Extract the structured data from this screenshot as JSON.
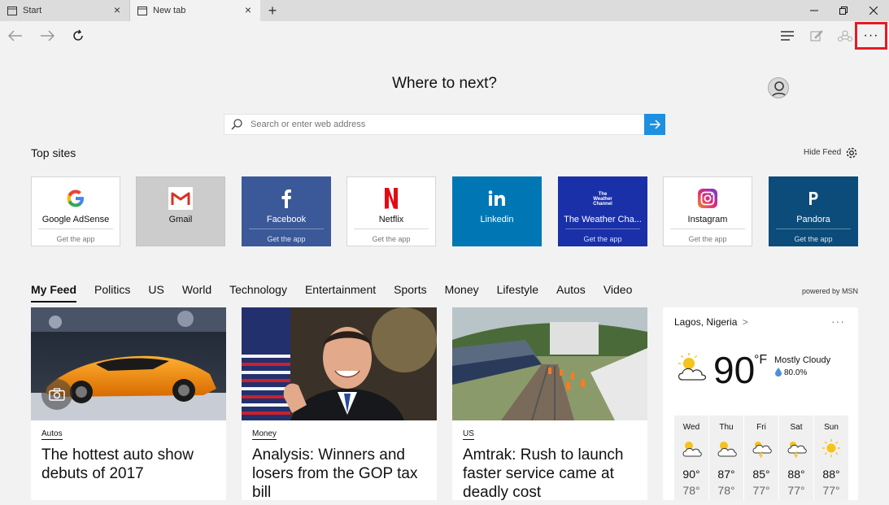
{
  "tabs": [
    {
      "label": "Start"
    },
    {
      "label": "New tab"
    }
  ],
  "hero": {
    "title": "Where to next?",
    "search_placeholder": "Search or enter web address"
  },
  "topsites": {
    "title": "Top sites",
    "hide_feed": "Hide Feed",
    "items": [
      {
        "name": "Google AdSense",
        "action": "Get the app",
        "bg": "#ffffff"
      },
      {
        "name": "Gmail",
        "action": "",
        "bg": "#cccccc"
      },
      {
        "name": "Facebook",
        "action": "Get the app",
        "bg": "#3b5998"
      },
      {
        "name": "Netflix",
        "action": "Get the app",
        "bg": "#ffffff"
      },
      {
        "name": "Linkedin",
        "action": "",
        "bg": "#0077b5"
      },
      {
        "name": "The Weather Cha...",
        "action": "Get the app",
        "bg": "#1a30a8",
        "logo_text": "The Weather Channel"
      },
      {
        "name": "Instagram",
        "action": "Get the app",
        "bg": "#ffffff"
      },
      {
        "name": "Pandora",
        "action": "Get the app",
        "bg": "#0b4c7a"
      }
    ]
  },
  "feed": {
    "tabs": [
      "My Feed",
      "Politics",
      "US",
      "World",
      "Technology",
      "Entertainment",
      "Sports",
      "Money",
      "Lifestyle",
      "Autos",
      "Video"
    ],
    "active_tab": "My Feed",
    "powered_by": "powered by MSN",
    "cards": [
      {
        "category": "Autos",
        "title": "The hottest auto show debuts of 2017"
      },
      {
        "category": "Money",
        "title": "Analysis: Winners and losers from the GOP tax bill"
      },
      {
        "category": "US",
        "title": "Amtrak: Rush to launch faster service came at deadly cost"
      }
    ]
  },
  "weather": {
    "location": "Lagos, Nigeria",
    "chevron": ">",
    "more": "···",
    "temp": "90",
    "unit": "°F",
    "condition": "Mostly Cloudy",
    "precip": "80.0%",
    "forecast": [
      {
        "day": "Wed",
        "hi": "90°",
        "lo": "78°",
        "icon": "partly-sunny-icon"
      },
      {
        "day": "Thu",
        "hi": "87°",
        "lo": "78°",
        "icon": "partly-sunny-icon"
      },
      {
        "day": "Fri",
        "hi": "85°",
        "lo": "77°",
        "icon": "thunderstorm-icon"
      },
      {
        "day": "Sat",
        "hi": "88°",
        "lo": "77°",
        "icon": "thunderstorm-icon"
      },
      {
        "day": "Sun",
        "hi": "88°",
        "lo": "77°",
        "icon": "sunny-icon"
      }
    ]
  },
  "colors": {
    "accent": "#1e90e0",
    "highlight": "#e31c24"
  }
}
